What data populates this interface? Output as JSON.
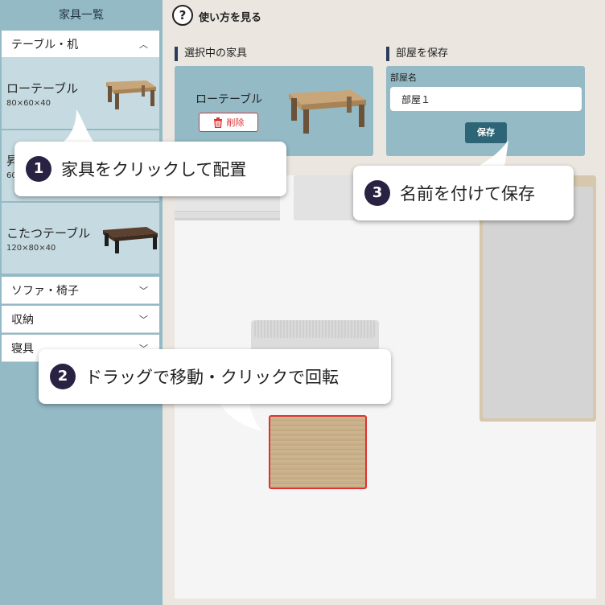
{
  "sidebar": {
    "title": "家具一覧",
    "categories": [
      {
        "label": "テーブル・机",
        "chevron": "^"
      },
      {
        "label": "ソファ・椅子",
        "chevron": "⌄"
      },
      {
        "label": "収納",
        "chevron": "⌄"
      },
      {
        "label": "寝具",
        "chevron": "⌄"
      }
    ],
    "items": [
      {
        "name": "ローテーブル",
        "size": "80×60×40",
        "icon": "low-table-icon"
      },
      {
        "name": "昇",
        "size": "60",
        "icon": "lift-table-icon"
      },
      {
        "name": "こたつテーブル",
        "size": "120×80×40",
        "icon": "kotatsu-table-icon"
      }
    ]
  },
  "header": {
    "help_icon": "?",
    "help_label": "使い方を見る"
  },
  "selected": {
    "section_title": "選択中の家具",
    "name": "ローテーブル",
    "delete_label": "削除"
  },
  "save": {
    "section_title": "部屋を保存",
    "field_label": "部屋名",
    "room_name": "部屋１",
    "button_label": "保存"
  },
  "tutorial": {
    "step1": {
      "num": "1",
      "text": "家具をクリックして配置"
    },
    "step2": {
      "num": "2",
      "text": "ドラッグで移動・クリックで回転"
    },
    "step3": {
      "num": "3",
      "text": "名前を付けて保存"
    }
  },
  "colors": {
    "sidebar_bg": "#94bac6",
    "accent_dark": "#2e6576",
    "delete_red": "#e03131",
    "selection_red": "#e03131",
    "step_badge": "#2a2242"
  }
}
